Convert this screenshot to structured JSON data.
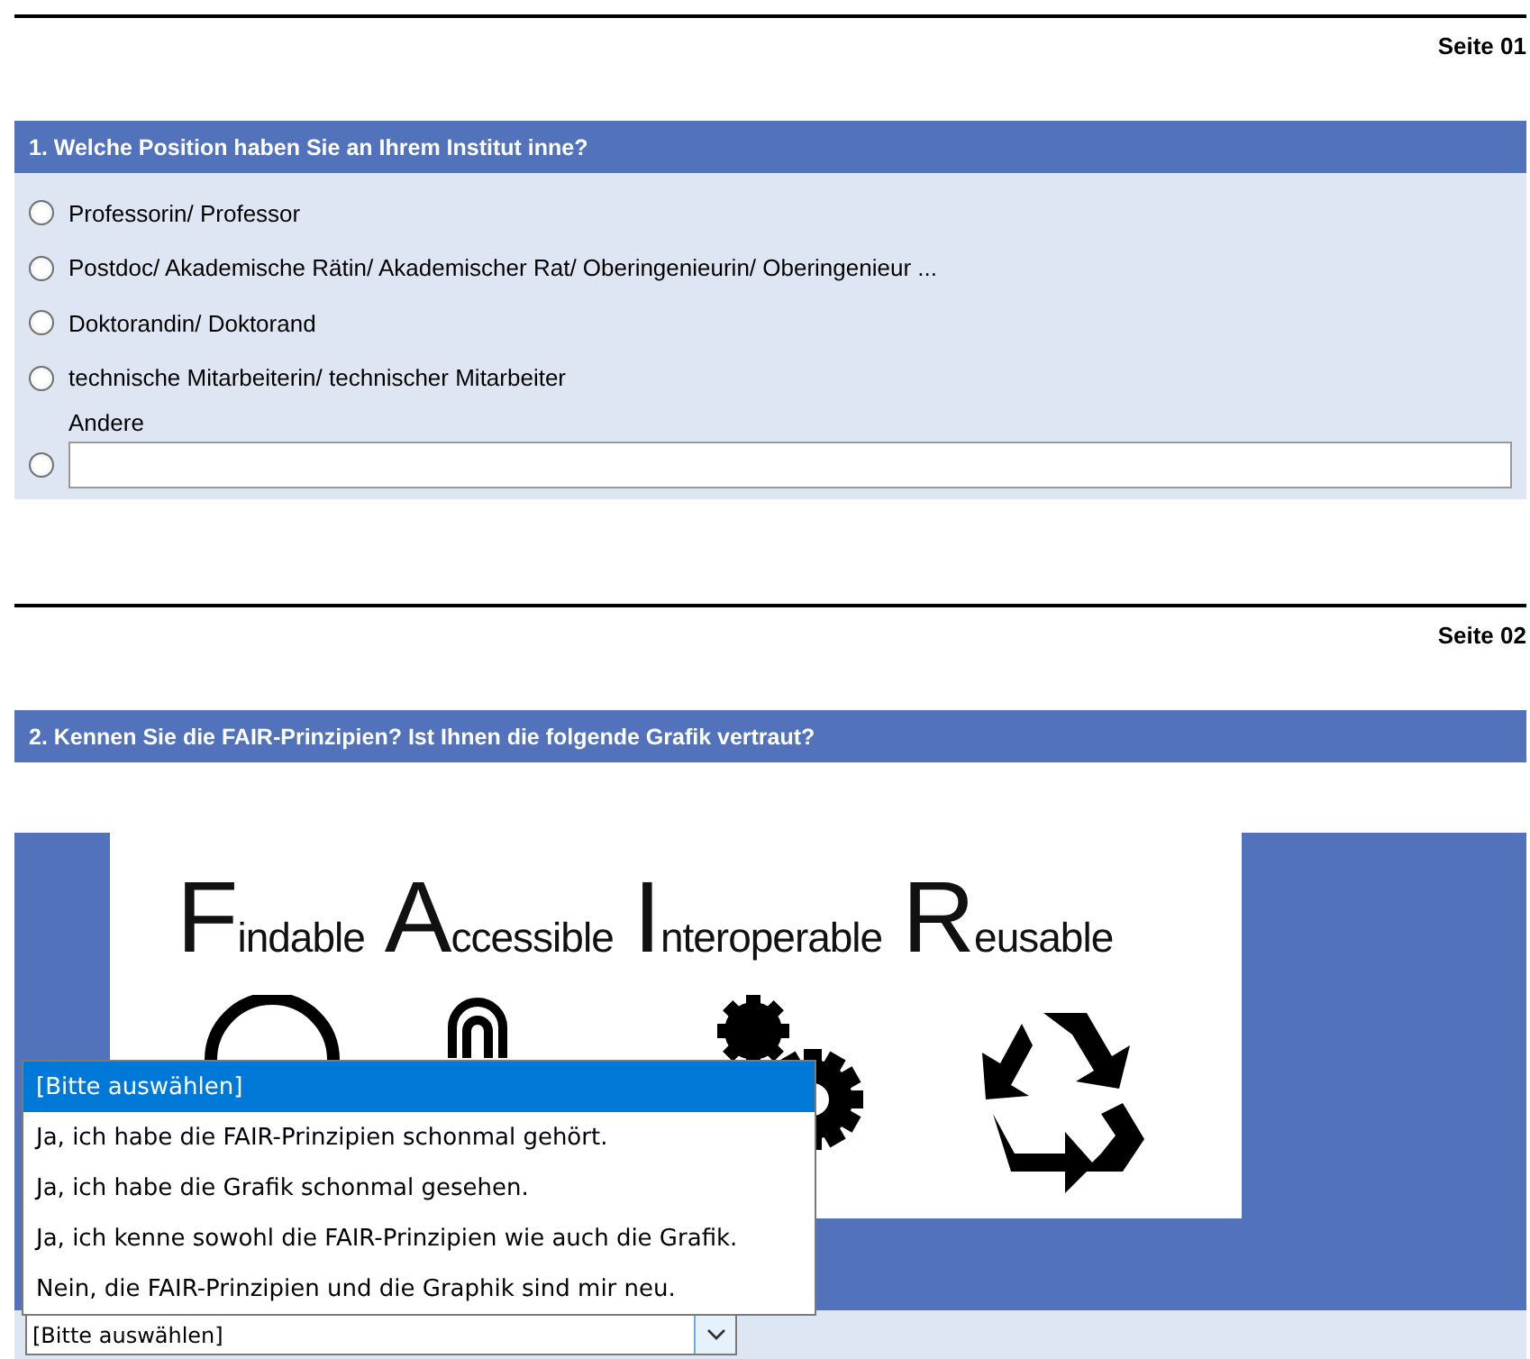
{
  "pages": [
    {
      "label": "Seite 01",
      "question": {
        "kind": "radio",
        "title": "1. Welche Position haben Sie an Ihrem Institut inne?",
        "options": [
          {
            "kind": "plain",
            "label": "Professorin/ Professor",
            "selected": false
          },
          {
            "kind": "plain",
            "label": "Postdoc/ Akademische Rätin/ Akademischer Rat/ Oberingenieurin/ Oberingenieur ...",
            "selected": false
          },
          {
            "kind": "plain",
            "label": "Doktorandin/ Doktorand",
            "selected": false
          },
          {
            "kind": "plain",
            "label": "technische Mitarbeiterin/ technischer Mitarbeiter",
            "selected": false
          },
          {
            "kind": "text_entry",
            "label": "Andere",
            "selected": false
          }
        ]
      }
    },
    {
      "label": "Seite 02",
      "question": {
        "kind": "graphic_select",
        "title": "2. Kennen Sie die FAIR-Prinzipien? Ist Ihnen die folgende Grafik vertraut?",
        "graphic": {
          "words": [
            "Findable",
            "Accessible",
            "Interoperable",
            "Reusable"
          ]
        },
        "select": {
          "value": "[Bitte auswählen]",
          "expanded": true,
          "options": [
            {
              "label": "[Bitte auswählen]",
              "selected": true
            },
            {
              "label": "Ja, ich habe die FAIR-Prinzipien schonmal gehört.",
              "selected": false
            },
            {
              "label": "Ja, ich habe die Grafik schonmal gesehen.",
              "selected": false
            },
            {
              "label": "Ja, ich kenne sowohl die FAIR-Prinzipien wie auch die Grafik.",
              "selected": false
            },
            {
              "label": "Nein, die FAIR-Prinzipien und die Graphik sind mir neu.",
              "selected": false
            }
          ]
        }
      }
    }
  ]
}
